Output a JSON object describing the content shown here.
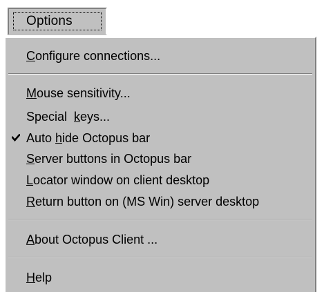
{
  "menu": {
    "title": "Options",
    "groups": [
      [
        {
          "mnemonic": "C",
          "rest": "onfigure connections...",
          "checked": false
        }
      ],
      [
        {
          "mnemonic": "M",
          "rest": "ouse sensitivity...",
          "checked": false
        },
        {
          "before": "Special  ",
          "mnemonic": "k",
          "rest": "eys...",
          "checked": false
        },
        {
          "before": "Auto ",
          "mnemonic": "h",
          "rest": "ide Octopus bar",
          "checked": true
        },
        {
          "mnemonic": "S",
          "rest": "erver buttons in Octopus bar",
          "checked": false
        },
        {
          "mnemonic": "L",
          "rest": "ocator window on client desktop",
          "checked": false
        },
        {
          "mnemonic": "R",
          "rest": "eturn button on (MS Win) server desktop",
          "checked": false
        }
      ],
      [
        {
          "mnemonic": "A",
          "rest": "bout Octopus Client ...",
          "checked": false
        }
      ],
      [
        {
          "mnemonic": "H",
          "rest": "elp",
          "checked": false
        }
      ]
    ]
  },
  "icons": {
    "checkmark": "check-icon"
  },
  "colors": {
    "menu_face": "#c0c0c0",
    "highlight": "#ffffff",
    "shadow": "#808080",
    "text": "#000000"
  }
}
